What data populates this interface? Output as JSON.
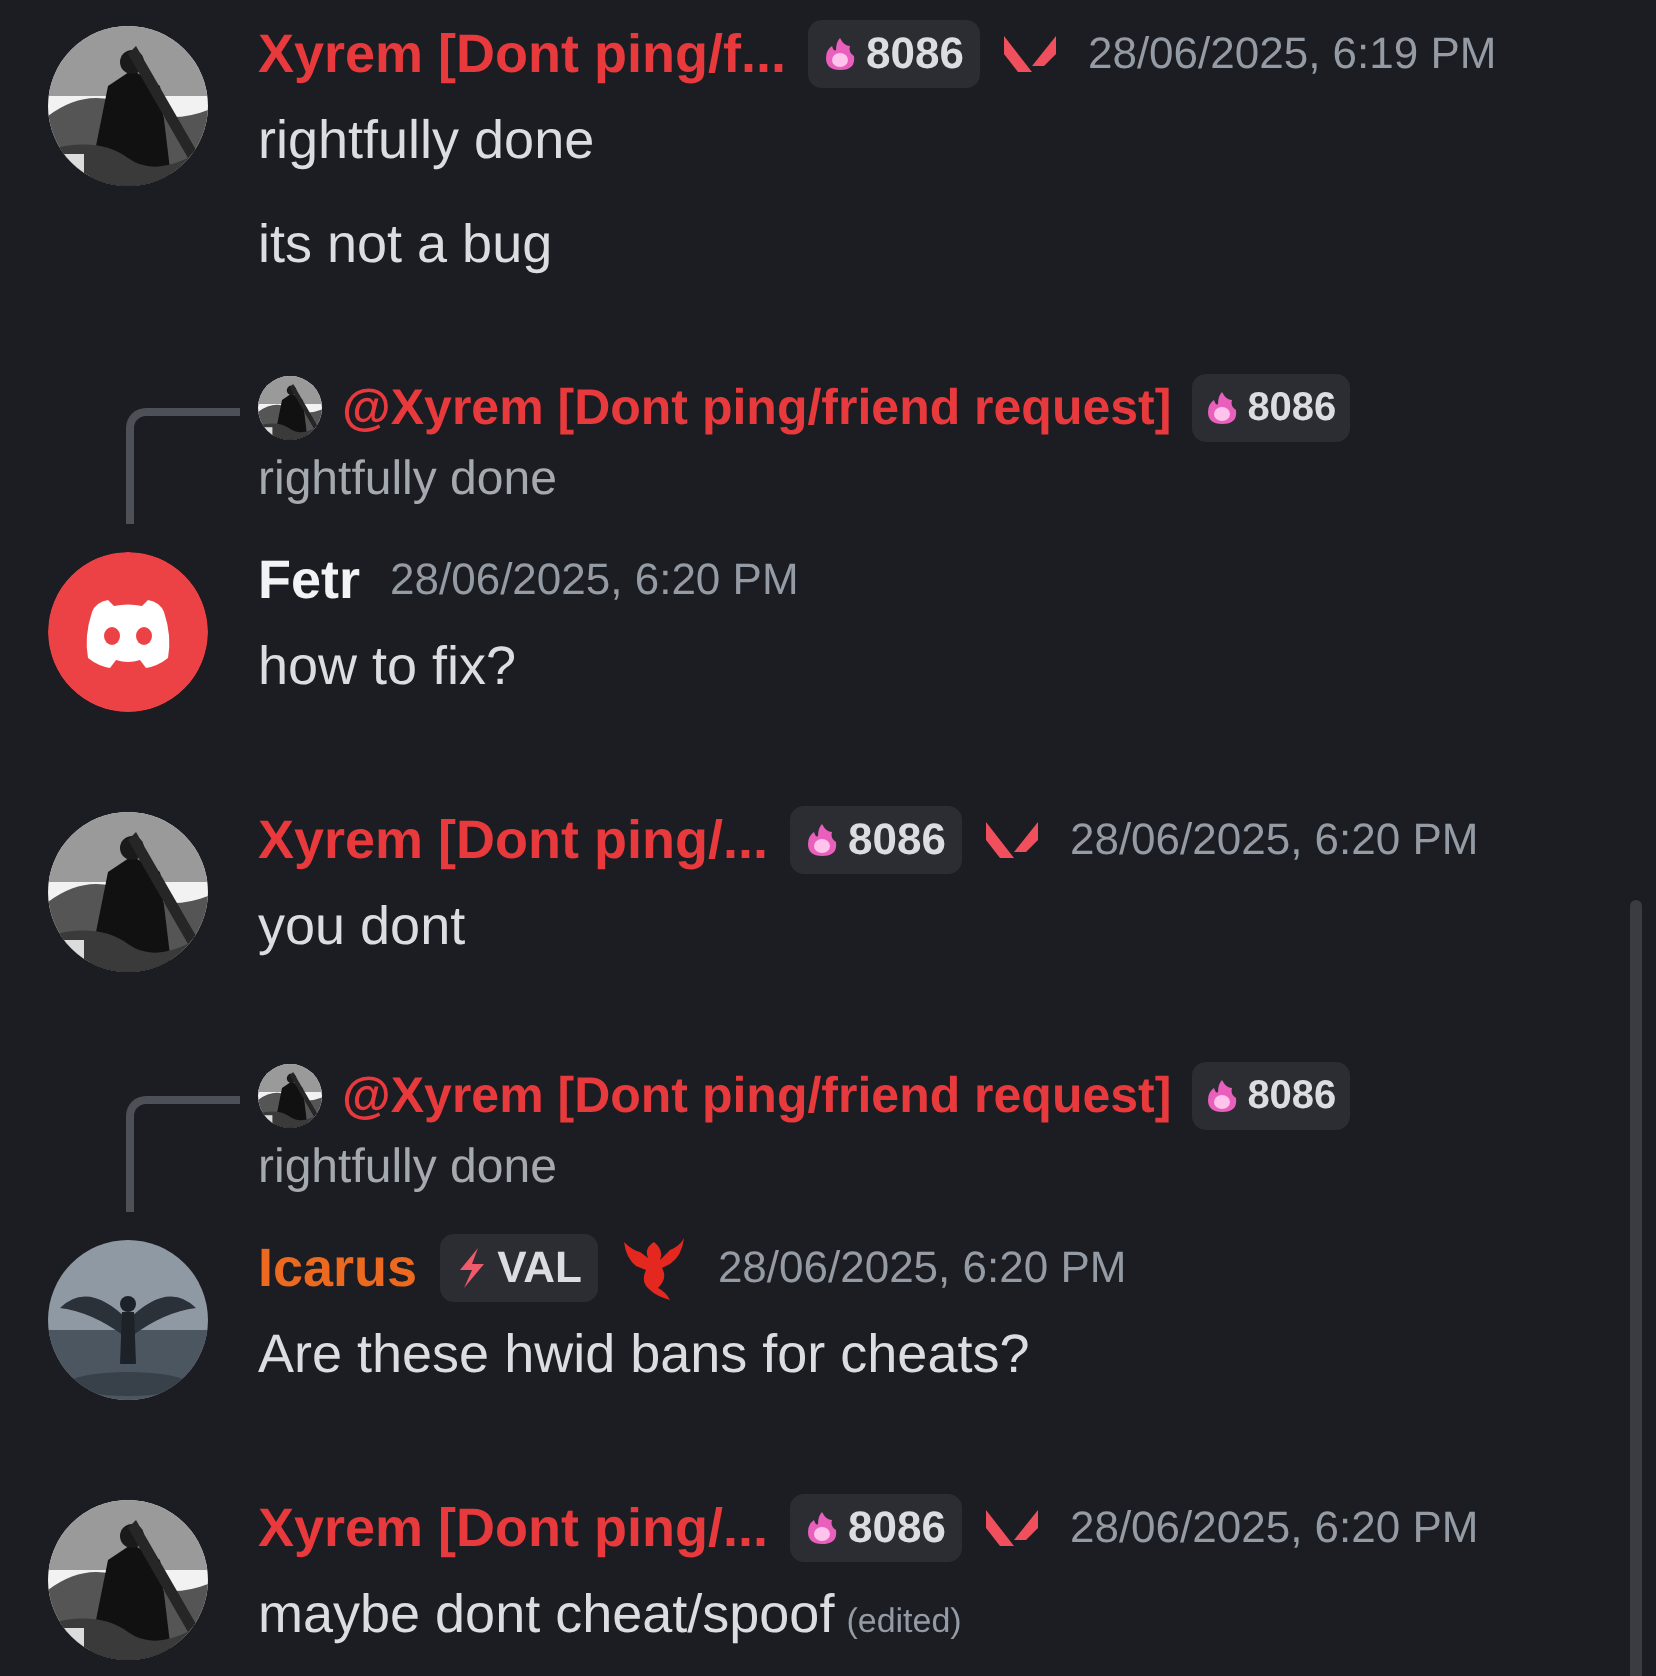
{
  "messages": [
    {
      "author": "Xyrem [Dont ping/f...",
      "color": "#e8393d",
      "avatar": {
        "kind": "picture"
      },
      "badges": [
        {
          "kind": "tag-flame",
          "text": "8086"
        },
        {
          "kind": "logo-v"
        }
      ],
      "timestamp": "28/06/2025, 6:19 PM",
      "lines": [
        {
          "text": "rightfully done"
        },
        {
          "text": "its not a bug"
        }
      ]
    },
    {
      "author": "Fetr",
      "color": "#f2f3f5",
      "avatar": {
        "kind": "default"
      },
      "reply": {
        "author": "@Xyrem [Dont ping/friend request]",
        "color": "#e8393d",
        "avatar": {
          "kind": "picture"
        },
        "badges": [
          {
            "kind": "tag-flame",
            "text": "8086"
          }
        ],
        "text": "rightfully done"
      },
      "timestamp": "28/06/2025, 6:20 PM",
      "lines": [
        {
          "text": "how to fix?"
        }
      ]
    },
    {
      "author": "Xyrem [Dont ping/...",
      "color": "#e8393d",
      "avatar": {
        "kind": "picture"
      },
      "badges": [
        {
          "kind": "tag-flame",
          "text": "8086"
        },
        {
          "kind": "logo-v"
        }
      ],
      "timestamp": "28/06/2025, 6:20 PM",
      "lines": [
        {
          "text": "you dont"
        }
      ]
    },
    {
      "author": "Icarus",
      "color": "#ec6a1f",
      "avatar": {
        "kind": "picture"
      },
      "reply": {
        "author": "@Xyrem [Dont ping/friend request]",
        "color": "#e8393d",
        "avatar": {
          "kind": "picture"
        },
        "badges": [
          {
            "kind": "tag-flame",
            "text": "8086"
          }
        ],
        "text": "rightfully done"
      },
      "badges": [
        {
          "kind": "tag-bolt",
          "text": "VAL"
        },
        {
          "kind": "dragon"
        }
      ],
      "timestamp": "28/06/2025, 6:20 PM",
      "lines": [
        {
          "text": "Are these hwid bans for cheats?"
        }
      ]
    },
    {
      "author": "Xyrem [Dont ping/...",
      "color": "#e8393d",
      "avatar": {
        "kind": "picture"
      },
      "badges": [
        {
          "kind": "tag-flame",
          "text": "8086"
        },
        {
          "kind": "logo-v"
        }
      ],
      "timestamp": "28/06/2025, 6:20 PM",
      "lines": [
        {
          "text": "maybe dont cheat/spoof",
          "edited": "(edited)"
        }
      ]
    }
  ]
}
